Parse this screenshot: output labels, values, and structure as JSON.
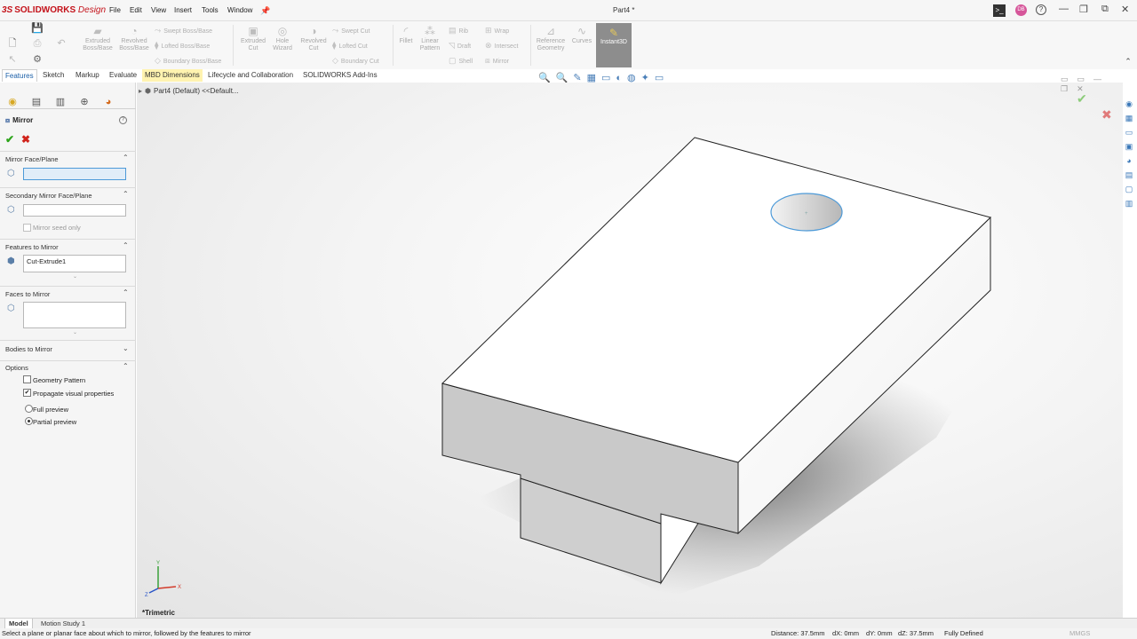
{
  "app": {
    "logo_ds": "3S",
    "logo_main": "SOLIDWORKS",
    "logo_tail": "Design",
    "document_title": "Part4 *"
  },
  "menu": [
    "File",
    "Edit",
    "View",
    "Insert",
    "Tools",
    "Window"
  ],
  "titlebar_icons": {
    "pin": "pin-icon",
    "terminal": "terminal-icon",
    "user": "DB",
    "help": "?"
  },
  "command_manager": {
    "large": [
      {
        "label": "Extruded Boss/Base"
      },
      {
        "label": "Revolved Boss/Base"
      },
      {
        "label": "Extruded Cut"
      },
      {
        "label": "Hole Wizard"
      },
      {
        "label": "Revolved Cut"
      },
      {
        "label": "Fillet"
      },
      {
        "label": "Linear Pattern"
      },
      {
        "label": "Reference Geometry"
      },
      {
        "label": "Curves"
      },
      {
        "label": "Instant3D"
      }
    ],
    "small": [
      "Swept Boss/Base",
      "Lofted Boss/Base",
      "Boundary Boss/Base",
      "Swept Cut",
      "Lofted Cut",
      "Boundary Cut",
      "Rib",
      "Draft",
      "Shell",
      "Wrap",
      "Intersect",
      "Mirror"
    ]
  },
  "tabs": [
    "Features",
    "Sketch",
    "Markup",
    "Evaluate",
    "MBD Dimensions",
    "Lifecycle and Collaboration",
    "SOLIDWORKS Add-Ins"
  ],
  "tree": {
    "root": "Part4 (Default) <<Default..."
  },
  "property_manager": {
    "title": "Mirror",
    "help": "?",
    "ok": "✔",
    "cancel": "✖",
    "mirror_face": {
      "header": "Mirror Face/Plane",
      "value": ""
    },
    "secondary": {
      "header": "Secondary Mirror Face/Plane",
      "value": "",
      "seed_label": "Mirror seed only"
    },
    "features": {
      "header": "Features to Mirror",
      "items": [
        "Cut-Extrude1"
      ]
    },
    "faces": {
      "header": "Faces to Mirror",
      "value": ""
    },
    "bodies": {
      "header": "Bodies to Mirror"
    },
    "options": {
      "header": "Options",
      "geometry_pattern": {
        "label": "Geometry Pattern",
        "checked": false
      },
      "propagate": {
        "label": "Propagate visual properties",
        "checked": true
      },
      "full_preview": {
        "label": "Full preview",
        "selected": false
      },
      "partial_preview": {
        "label": "Partial preview",
        "selected": true
      }
    }
  },
  "view": {
    "orientation": "*Trimetric",
    "axis_labels": {
      "x": "X",
      "y": "Y",
      "z": "Z"
    }
  },
  "bottom_tabs": [
    "Model",
    "Motion Study 1"
  ],
  "status": {
    "hint": "Select a plane or planar face about which to mirror, followed by the features to mirror",
    "distance": "Distance: 37.5mm",
    "dx": "dX: 0mm",
    "dy": "dY: 0mm",
    "dz": "dZ: 37.5mm",
    "state": "Fully Defined",
    "units": "MMGS"
  },
  "colors": {
    "accent": "#1b5fa8",
    "brand": "#c4121a",
    "ok": "#2ea51c",
    "cancel": "#d0231b",
    "selection": "#4d9ad8"
  }
}
